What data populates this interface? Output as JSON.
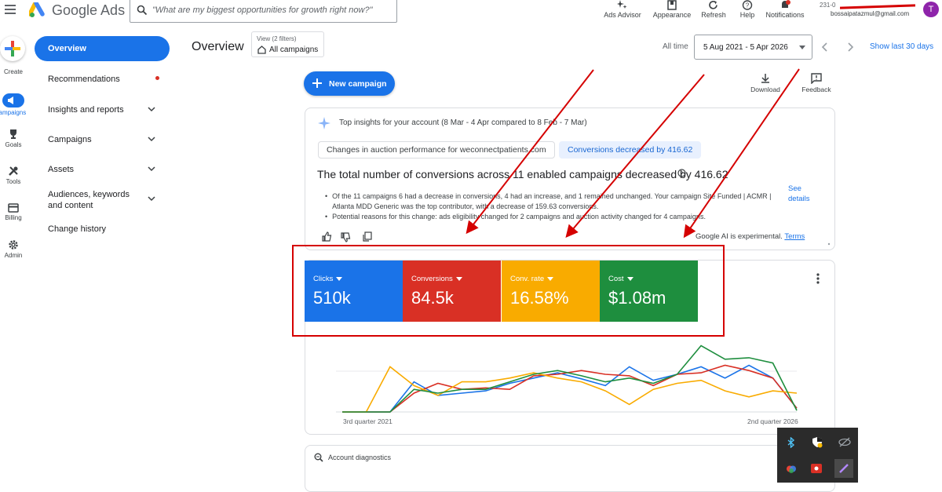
{
  "header": {
    "app_name": "Google Ads",
    "search_placeholder": "\"What are my biggest opportunities for growth right now?\"",
    "tools": [
      {
        "label": "Ads Advisor",
        "icon": "sparkle-icon"
      },
      {
        "label": "Appearance",
        "icon": "appearance-icon"
      },
      {
        "label": "Refresh",
        "icon": "refresh-icon"
      },
      {
        "label": "Help",
        "icon": "help-icon"
      },
      {
        "label": "Notifications",
        "icon": "bell-icon"
      }
    ],
    "account_line1": "231-0",
    "account_email": "bossaipatazmul@gmail.com",
    "avatar_letter": "T",
    "avatar_color": "#8e24aa"
  },
  "rail": [
    {
      "label": "Create",
      "icon": "plus-icon"
    },
    {
      "label": "Campaigns",
      "icon": "campaigns-icon"
    },
    {
      "label": "Goals",
      "icon": "trophy-icon"
    },
    {
      "label": "Tools",
      "icon": "tools-icon"
    },
    {
      "label": "Billing",
      "icon": "card-icon"
    },
    {
      "label": "Admin",
      "icon": "gear-icon"
    }
  ],
  "nav": {
    "overview": "Overview",
    "recommendations": "Recommendations",
    "insights": "Insights and reports",
    "campaigns": "Campaigns",
    "assets": "Assets",
    "audiences": "Audiences, keywords and content",
    "change_history": "Change history"
  },
  "page": {
    "title": "Overview",
    "view_filter_small": "View (2 filters)",
    "view_filter": "All campaigns",
    "range_label": "All time",
    "date_range": "5 Aug 2021 - 5 Apr 2026",
    "show_last": "Show last 30 days",
    "new_campaign": "New campaign",
    "download": "Download",
    "feedback": "Feedback"
  },
  "insights": {
    "header": "Top insights for your account (8 Mar - 4 Apr compared to 8 Feb - 7 Mar)",
    "chip1": "Changes in auction performance for weconnectpatients.com",
    "chip2": "Conversions decreased by 416.62",
    "headline": "The total number of conversions across 11 enabled campaigns decreased by 416.62",
    "bullet1": "Of the 11 campaigns 6 had a decrease in conversions, 4 had an increase, and 1 remained unchanged. Your campaign Site Funded | ACMR | Atlanta MDD Generic was the top contributor, with a decrease of 159.63 conversions.",
    "bullet2": "Potential reasons for this change: ads eligibility changed for 2 campaigns and auction activity changed for 4 campaigns.",
    "see_details": "See details",
    "ai_note": "Google AI is experimental.",
    "terms": "Terms"
  },
  "metrics": [
    {
      "label": "Clicks",
      "value": "510k",
      "color": "#1a73e8"
    },
    {
      "label": "Conversions",
      "value": "84.5k",
      "color": "#d93025"
    },
    {
      "label": "Conv. rate",
      "value": "16.58%",
      "color": "#f9ab00"
    },
    {
      "label": "Cost",
      "value": "$1.08m",
      "color": "#1e8e3e"
    }
  ],
  "chart_data": {
    "type": "line",
    "x_start_label": "3rd quarter 2021",
    "x_end_label": "2nd quarter 2026",
    "series": [
      {
        "color": "#1a73e8",
        "values": [
          0,
          0,
          0,
          0.4,
          0.22,
          0.25,
          0.28,
          0.38,
          0.45,
          0.52,
          0.44,
          0.35,
          0.6,
          0.42,
          0.5,
          0.6,
          0.45,
          0.62,
          0.45,
          0.05
        ]
      },
      {
        "color": "#d93025",
        "values": [
          0,
          0,
          0,
          0.25,
          0.38,
          0.3,
          0.32,
          0.3,
          0.48,
          0.5,
          0.55,
          0.5,
          0.48,
          0.35,
          0.5,
          0.52,
          0.62,
          0.55,
          0.45,
          0.05
        ]
      },
      {
        "color": "#f9ab00",
        "values": [
          0,
          0,
          0.6,
          0.35,
          0.22,
          0.4,
          0.4,
          0.45,
          0.52,
          0.45,
          0.4,
          0.28,
          0.1,
          0.3,
          0.38,
          0.42,
          0.28,
          0.2,
          0.28,
          0.25
        ]
      },
      {
        "color": "#1e8e3e",
        "values": [
          0,
          0,
          0,
          0.3,
          0.25,
          0.3,
          0.3,
          0.4,
          0.5,
          0.55,
          0.48,
          0.4,
          0.45,
          0.38,
          0.5,
          0.88,
          0.7,
          0.72,
          0.65,
          0.02
        ]
      }
    ]
  },
  "account_diagnostics": "Account diagnostics",
  "colors": {
    "accent": "#1a73e8",
    "annotation": "#d50000"
  }
}
